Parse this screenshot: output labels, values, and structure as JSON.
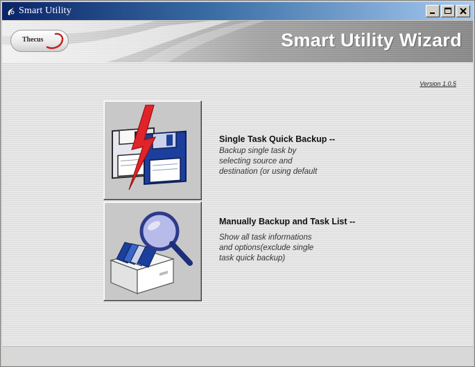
{
  "window": {
    "title": "Smart Utility",
    "app_icon": "smart-utility-icon",
    "controls": [
      "minimize-icon",
      "maximize-icon",
      "close-icon"
    ]
  },
  "header": {
    "logo_text": "Thecus",
    "title": "Smart Utility Wizard"
  },
  "main": {
    "version": "Version 1.0.5",
    "tasks": [
      {
        "title": "Single Task Quick Backup --",
        "description": "Backup single task by\nselecting source and\ndestination (or using default",
        "icon": "floppy-backup-icon"
      },
      {
        "title": "Manually Backup and Task List --",
        "description": "Show all task informations\nand options(exclude single\ntask quick backup)",
        "icon": "magnifier-box-icon"
      }
    ]
  },
  "colors": {
    "titlebar_start": "#0a246a",
    "titlebar_end": "#a6caf0",
    "window_face": "#d4d0c8",
    "disk_blue": "#1c3e9c",
    "lightning_red": "#e0242a"
  }
}
